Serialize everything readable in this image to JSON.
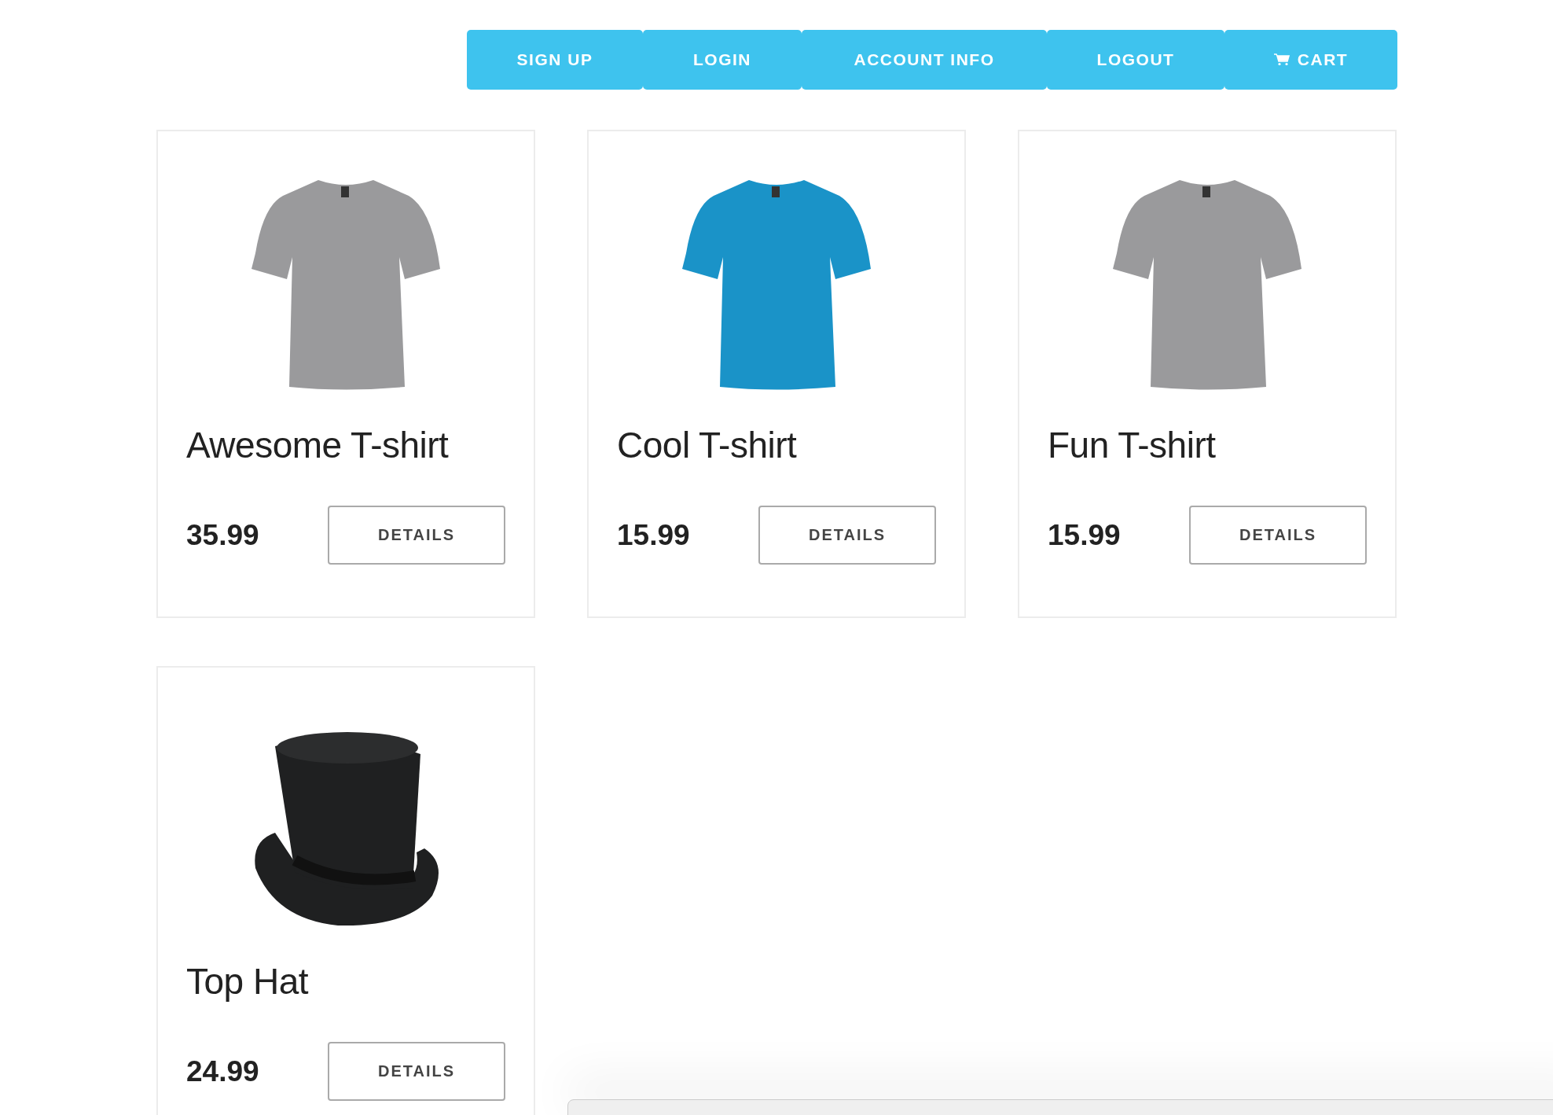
{
  "nav": [
    {
      "label": "SIGN UP",
      "kind": "text"
    },
    {
      "label": "LOGIN",
      "kind": "text"
    },
    {
      "label": "ACCOUNT INFO",
      "kind": "text"
    },
    {
      "label": "LOGOUT",
      "kind": "text"
    },
    {
      "label": "CART",
      "kind": "cart"
    }
  ],
  "products": [
    {
      "kind": "tshirt",
      "color": "#9a9a9c",
      "name": "Awesome T-shirt",
      "price": "35.99",
      "button": "DETAILS"
    },
    {
      "kind": "tshirt",
      "color": "#1a93c8",
      "name": "Cool T-shirt",
      "price": "15.99",
      "button": "DETAILS"
    },
    {
      "kind": "tshirt",
      "color": "#9a9a9c",
      "name": "Fun T-shirt",
      "price": "15.99",
      "button": "DETAILS"
    },
    {
      "kind": "hat",
      "color": "#1f2021",
      "name": "Top Hat",
      "price": "24.99",
      "button": "DETAILS"
    }
  ]
}
